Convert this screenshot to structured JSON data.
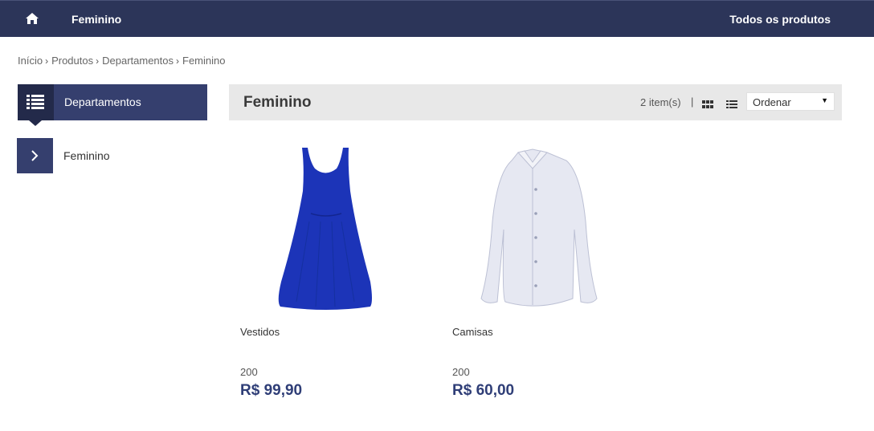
{
  "topbar": {
    "home_icon": "home-icon",
    "category": "Feminino",
    "all_products": "Todos os produtos"
  },
  "breadcrumb": [
    "Início",
    "Produtos",
    "Departamentos",
    "Feminino"
  ],
  "sidebar": {
    "header_icon": "list-icon",
    "header_label": "Departamentos",
    "items": [
      {
        "icon": "chevron-right-icon",
        "label": "Feminino"
      }
    ]
  },
  "content": {
    "title": "Feminino",
    "item_count": "2 item(s)",
    "separator": "|",
    "sort": {
      "selected": "Ordenar"
    }
  },
  "products": [
    {
      "name": "Vestidos",
      "qty": "200",
      "price": "R$ 99,90",
      "image": "blue-dress-image"
    },
    {
      "name": "Camisas",
      "qty": "200",
      "price": "R$ 60,00",
      "image": "white-shirt-image"
    }
  ],
  "colors": {
    "nav": "#2c3559",
    "accent": "#353f6e",
    "price": "#2f3e77"
  }
}
